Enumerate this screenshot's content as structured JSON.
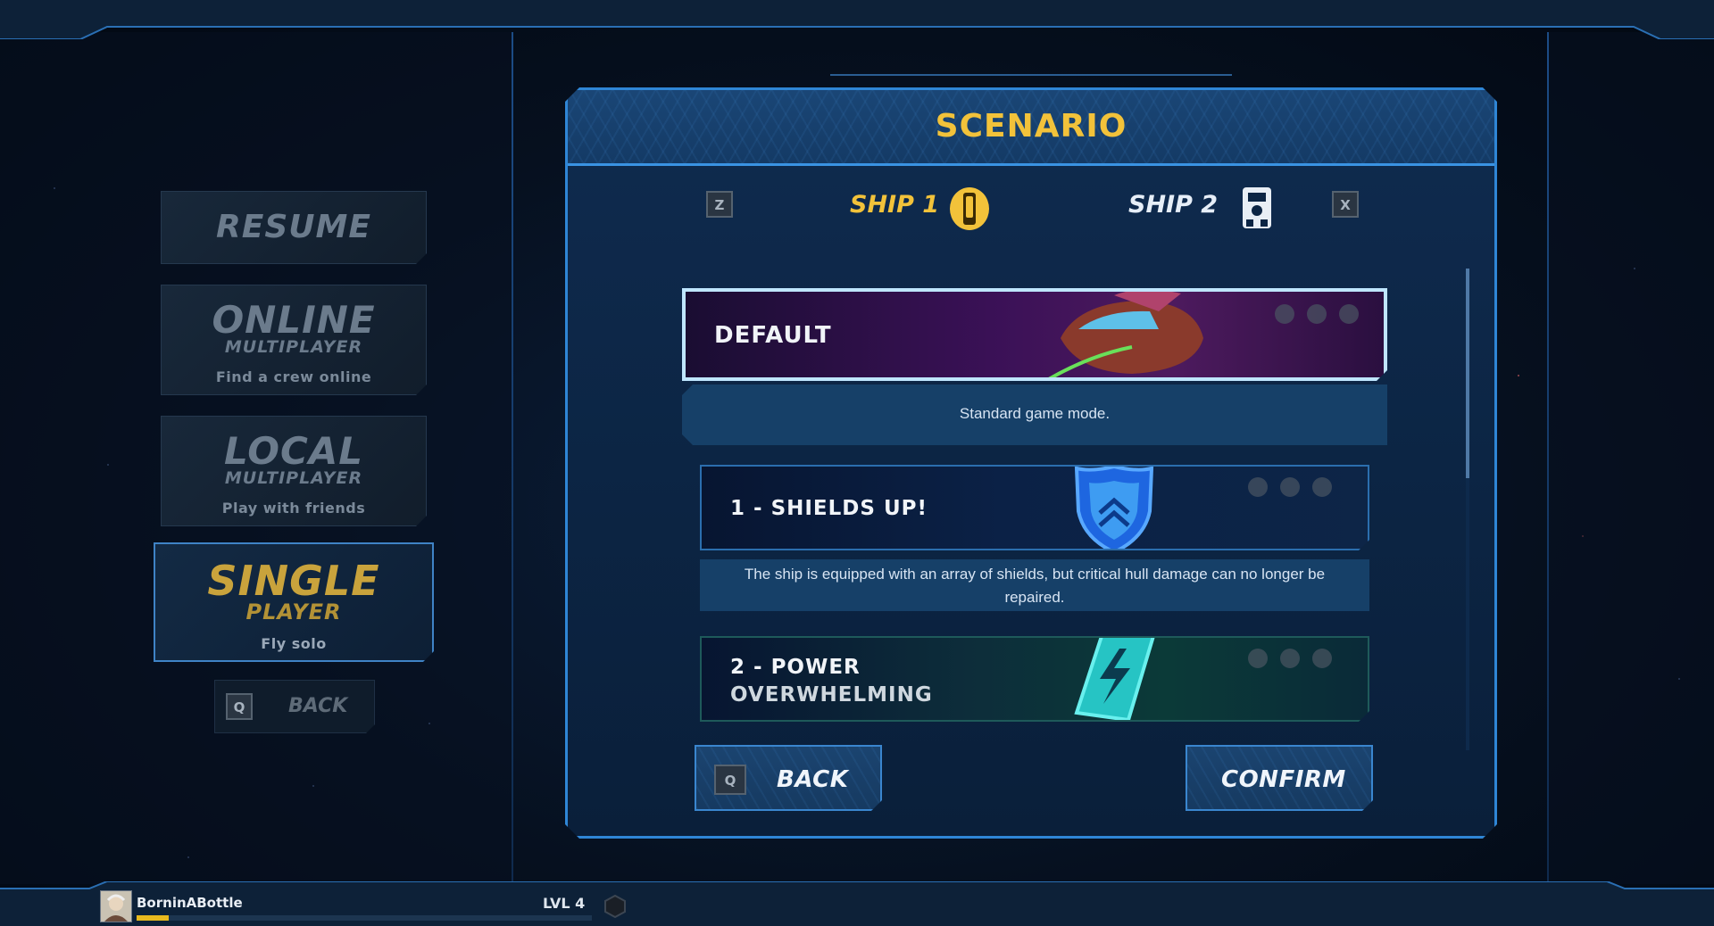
{
  "colors": {
    "accent_gold": "#f2c23a",
    "frame_blue": "#2f86d6",
    "xp_yellow": "#e8b91e"
  },
  "menu": {
    "resume": {
      "label": "RESUME"
    },
    "online": {
      "label": "ONLINE",
      "sub": "MULTIPLAYER",
      "hint": "Find a crew online"
    },
    "local": {
      "label": "LOCAL",
      "sub": "MULTIPLAYER",
      "hint": "Play with friends"
    },
    "single": {
      "label": "SINGLE",
      "sub": "PLAYER",
      "hint": "Fly solo"
    },
    "back": {
      "key": "Q",
      "label": "BACK"
    }
  },
  "dialog": {
    "title": "SCENARIO",
    "prev_key": "Z",
    "next_key": "X",
    "ships": [
      {
        "label": "SHIP 1",
        "icon": "ship-1-badge-icon",
        "selected": true
      },
      {
        "label": "SHIP 2",
        "icon": "ship-2-badge-icon",
        "selected": false
      }
    ],
    "scenarios": [
      {
        "title": "DEFAULT",
        "description": "Standard game mode.",
        "icon": "starship-image",
        "selected": true
      },
      {
        "title": "1 - SHIELDS UP!",
        "description": "The ship is equipped with an array of shields, but critical hull damage can no longer be repaired.",
        "icon": "shield-icon",
        "selected": false
      },
      {
        "title_line1": "2 - POWER",
        "title_line2": "OVERWHELMING",
        "icon": "lightning-card-icon",
        "selected": false
      }
    ],
    "difficulty_icons": [
      "easy-face-icon",
      "medium-face-icon",
      "hard-face-icon"
    ],
    "back": {
      "key": "Q",
      "label": "BACK"
    },
    "confirm": {
      "label": "CONFIRM"
    },
    "scroll_position": 0
  },
  "player": {
    "name": "BorninABottle",
    "level": "LVL 4",
    "xp_progress": 0.07,
    "avatar": "player-avatar"
  }
}
